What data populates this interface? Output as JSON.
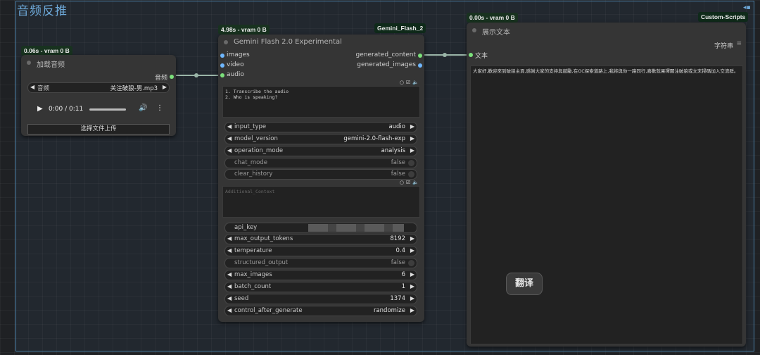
{
  "group": {
    "title": "音频反推"
  },
  "load_audio_node": {
    "badge": "0.06s - vram 0 B",
    "title": "加载音频",
    "output_label": "音频",
    "audio_widget": {
      "label": "音频",
      "value": "关注破狼-男.mp3"
    },
    "player": {
      "time": "0:00 / 0:11"
    },
    "upload_button": "选择文件上传"
  },
  "gemini_node": {
    "badge_left": "4.98s - vram 0 B",
    "badge_right": "Gemini_Flash_2",
    "title": "Gemini Flash 2.0 Experimental",
    "inputs": [
      "images",
      "video",
      "audio"
    ],
    "outputs": [
      "generated_content",
      "generated_images"
    ],
    "prompt_text": "1. Transcribe the audio\n2. Who is speaking?",
    "additional_context_placeholder": "Additional_Context",
    "widgets_top": [
      {
        "label": "input_type",
        "value": "audio"
      },
      {
        "label": "model_version",
        "value": "gemini-2.0-flash-exp"
      },
      {
        "label": "operation_mode",
        "value": "analysis"
      }
    ],
    "toggles_top": [
      {
        "label": "chat_mode",
        "value": "false"
      },
      {
        "label": "clear_history",
        "value": "false"
      }
    ],
    "api_key_label": "api_key",
    "max_output_tokens": {
      "label": "max_output_tokens",
      "value": "8192"
    },
    "temperature": {
      "label": "temperature",
      "value": "0.4"
    },
    "structured_output": {
      "label": "structured_output",
      "value": "false"
    },
    "max_images": {
      "label": "max_images",
      "value": "6"
    },
    "batch_count": {
      "label": "batch_count",
      "value": "1"
    },
    "seed": {
      "label": "seed",
      "value": "1374"
    },
    "control_after_generate": {
      "label": "control_after_generate",
      "value": "randomize"
    }
  },
  "show_text_node": {
    "badge_left": "0.00s - vram 0 B",
    "badge_right": "Custom-Scripts",
    "title": "展示文本",
    "input_label": "文本",
    "output_label": "字符串",
    "content": "大家好,歡迎來到破狼主頁,感謝大家的支持與鼓勵,在GC探索道路上,我將與你一路同行,喜歡就果擇關注破狼或文末掃碼加入交流群。"
  },
  "translate_button": "翻译",
  "colors": {
    "wire": "#9ab5a8",
    "port_green": "#7be07b",
    "port_blue": "#6fb7ff",
    "group_border": "#4a7fa6"
  }
}
